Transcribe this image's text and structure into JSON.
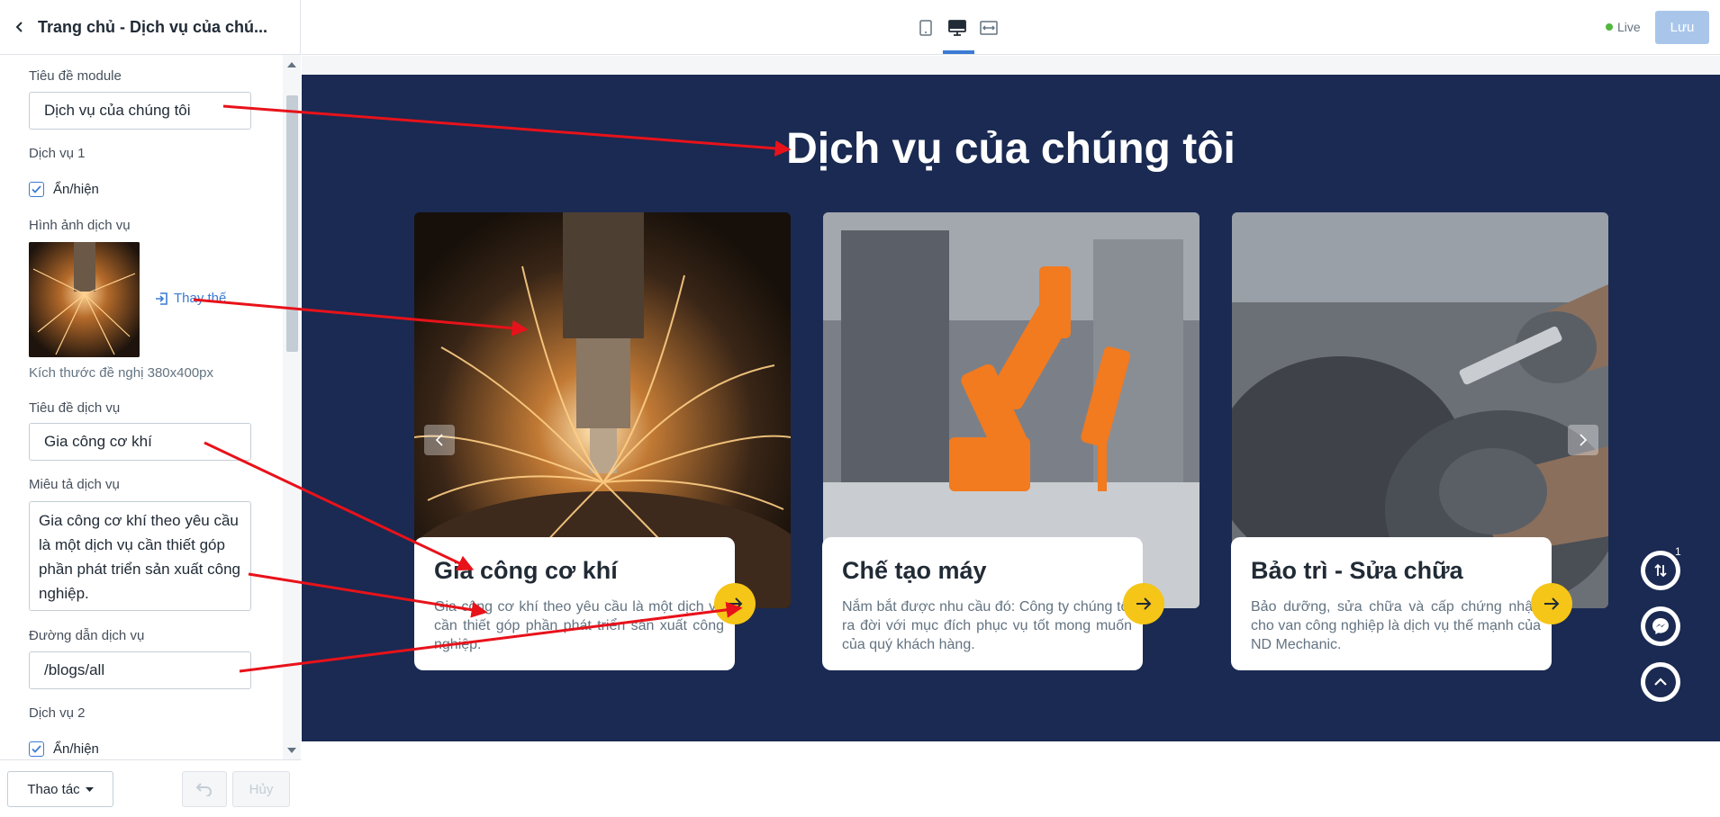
{
  "sidebar": {
    "title": "Trang chủ - Dịch vụ của chú...",
    "module_title_label": "Tiêu đề module",
    "module_title_value": "Dịch vụ của chúng tôi",
    "service1_label": "Dịch vụ 1",
    "visibility_label": "Ẩn/hiện",
    "image_label": "Hình ảnh dịch vụ",
    "replace_label": "Thay thế",
    "size_hint": "Kích thước đề nghị 380x400px",
    "service_title_label": "Tiêu đề dịch vụ",
    "service_title_value": "Gia công cơ khí",
    "service_desc_label": "Miêu tả dịch vụ",
    "service_desc_value": "Gia công cơ khí theo yêu cầu là một dịch vụ cần thiết góp phần phát triển sản xuất công nghiệp.",
    "service_link_label": "Đường dẫn dịch vụ",
    "service_link_value": "/blogs/all",
    "service2_label": "Dịch vụ 2",
    "visibility2_label": "Ẩn/hiện"
  },
  "footer": {
    "actions_label": "Thao tác",
    "cancel_label": "Hủy"
  },
  "topbar": {
    "live_label": "Live",
    "save_label": "Lưu"
  },
  "preview": {
    "heading": "Dịch vụ của chúng tôi",
    "cards": [
      {
        "title": "Gia công cơ khí",
        "desc": "Gia công cơ khí theo yêu cầu là một dịch vụ cần thiết góp phần phát triển sản xuất công nghiệp."
      },
      {
        "title": "Chế tạo máy",
        "desc": "Nắm bắt được nhu cầu đó: Công ty chúng tôi ra đời với mục đích phục vụ tốt mong muốn của quý khách hàng."
      },
      {
        "title": "Bảo trì - Sửa chữa",
        "desc": "Bảo dưỡng, sửa chữa và cấp chứng nhận cho van công nghiệp là dịch vụ thế mạnh của ND Mechanic."
      }
    ],
    "badge_count": "1"
  },
  "colors": {
    "section_bg": "#1a2a52",
    "accent_yellow": "#f5c518",
    "primary_blue": "#3b7bd4",
    "live_green": "#50b83c",
    "annotation_red": "#e8121a"
  },
  "icons": [
    "back-icon",
    "mobile-icon",
    "desktop-icon",
    "fullwidth-icon",
    "checkbox-checked-icon",
    "replace-icon",
    "undo-icon",
    "caret-down-icon",
    "arrow-right-icon",
    "chevron-left-icon",
    "chevron-right-icon",
    "transfer-icon",
    "messenger-icon",
    "chevron-up-icon"
  ]
}
